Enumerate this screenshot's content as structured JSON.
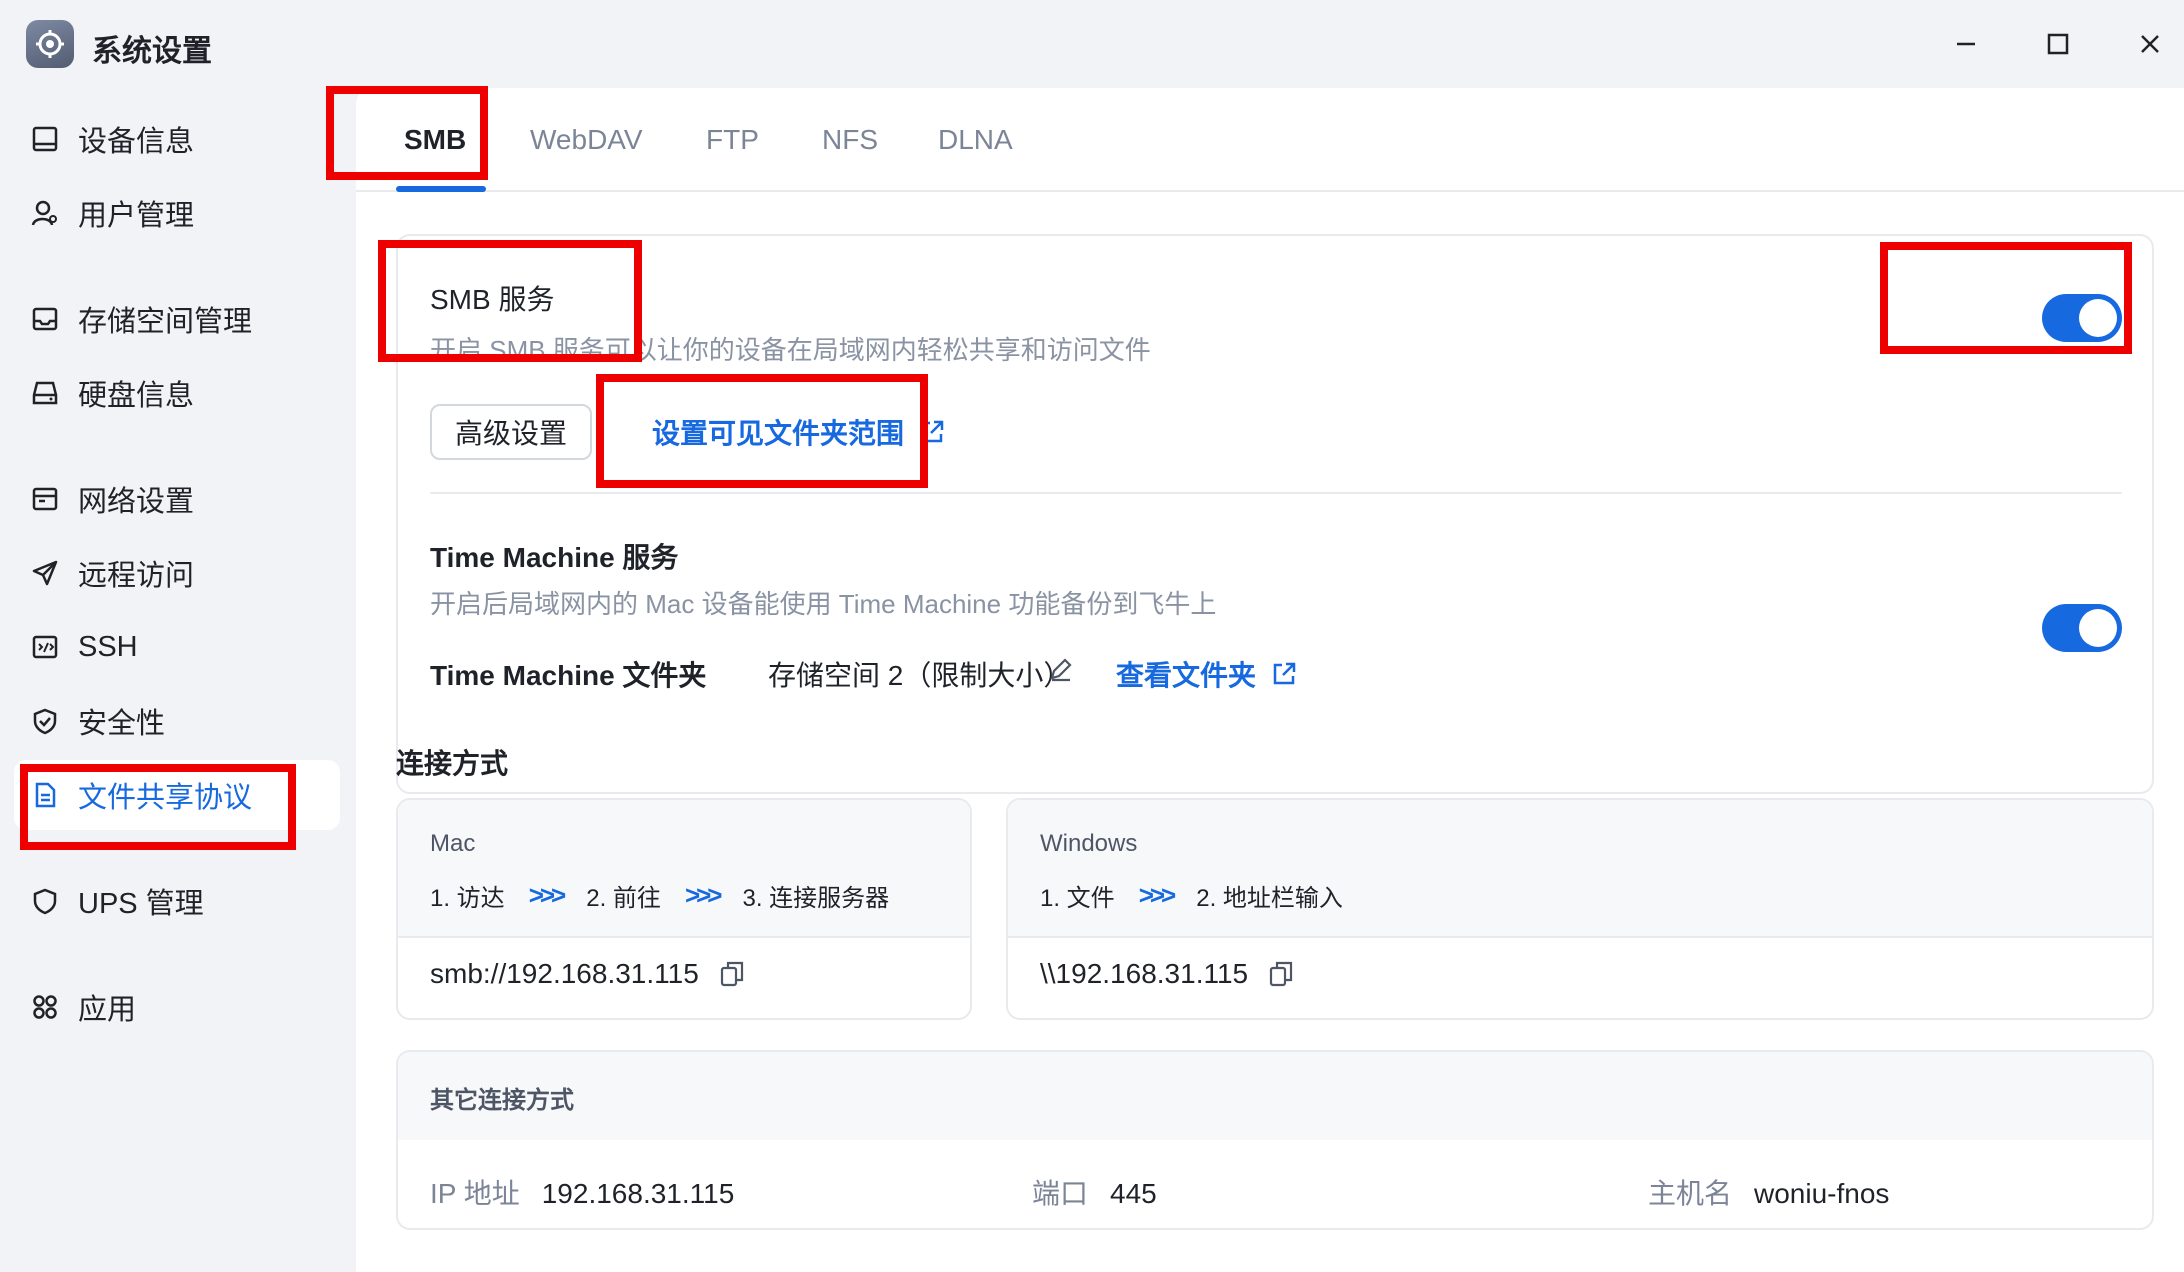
{
  "window": {
    "title": "系统设置"
  },
  "sidebar": {
    "items": [
      {
        "label": "设备信息",
        "icon": "device-icon"
      },
      {
        "label": "用户管理",
        "icon": "user-icon"
      },
      {
        "label": "存储空间管理",
        "icon": "storage-icon"
      },
      {
        "label": "硬盘信息",
        "icon": "disk-icon"
      },
      {
        "label": "网络设置",
        "icon": "network-icon"
      },
      {
        "label": "远程访问",
        "icon": "send-icon"
      },
      {
        "label": "SSH",
        "icon": "terminal-icon"
      },
      {
        "label": "安全性",
        "icon": "shield-check-icon"
      },
      {
        "label": "文件共享协议",
        "icon": "file-icon",
        "active": true
      },
      {
        "label": "UPS 管理",
        "icon": "shield-icon"
      },
      {
        "label": "应用",
        "icon": "apps-icon"
      }
    ]
  },
  "tabs": [
    "SMB",
    "WebDAV",
    "FTP",
    "NFS",
    "DLNA"
  ],
  "active_tab": "SMB",
  "smb": {
    "title": "SMB 服务",
    "description": "开启 SMB 服务可以让你的设备在局域网内轻松共享和访问文件",
    "enabled": true,
    "advanced_button": "高级设置",
    "folder_scope_link": "设置可见文件夹范围"
  },
  "time_machine": {
    "title": "Time Machine 服务",
    "description": "开启后局域网内的 Mac 设备能使用 Time Machine 功能备份到飞牛上",
    "enabled": true,
    "folder_label": "Time Machine 文件夹",
    "folder_value": "存储空间 2（限制大小）",
    "view_folder_link": "查看文件夹"
  },
  "connection": {
    "section_title": "连接方式",
    "mac": {
      "os": "Mac",
      "steps": [
        "1. 访达",
        "2. 前往",
        "3. 连接服务器"
      ],
      "address": "smb://192.168.31.115"
    },
    "windows": {
      "os": "Windows",
      "steps": [
        "1. 文件",
        "2. 地址栏输入"
      ],
      "address": "\\\\192.168.31.115"
    },
    "arrow": ">>>"
  },
  "other": {
    "title": "其它连接方式",
    "ip_label": "IP 地址",
    "ip_value": "192.168.31.115",
    "port_label": "端口",
    "port_value": "445",
    "host_label": "主机名",
    "host_value": "woniu-fnos"
  },
  "colors": {
    "accent": "#1769e0",
    "annotation": "#ee0000"
  }
}
